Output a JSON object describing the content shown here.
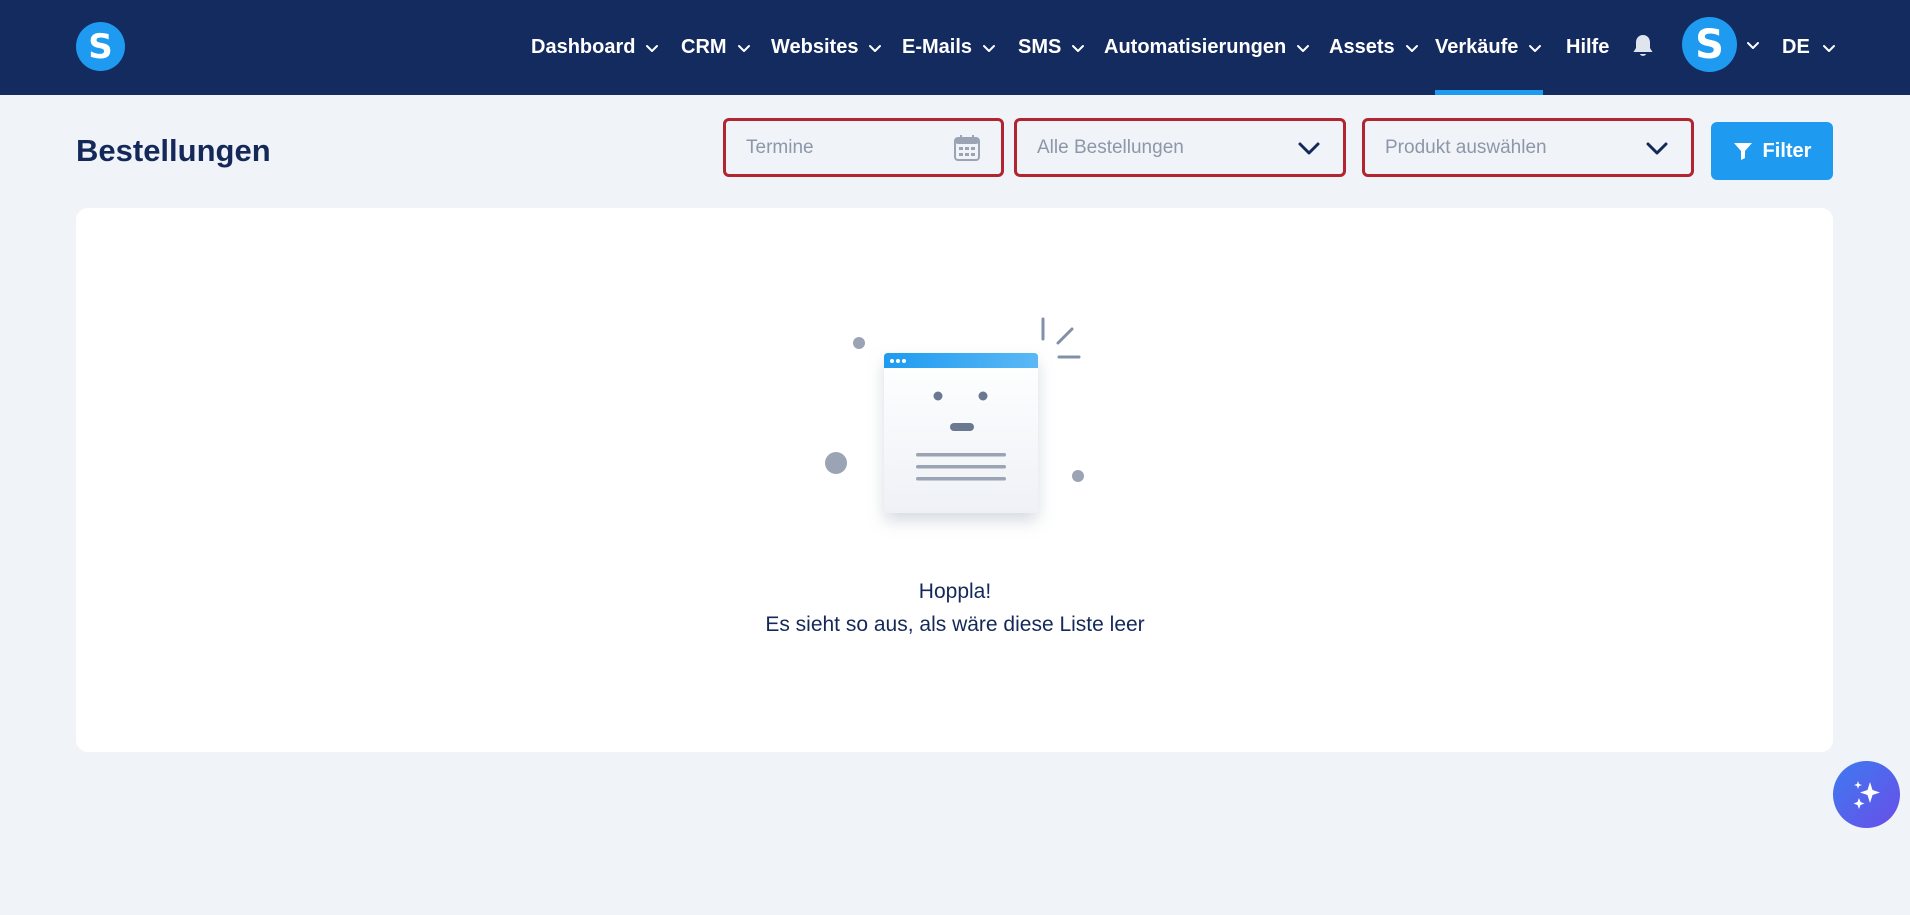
{
  "brand": {
    "logo_letter": "S"
  },
  "nav": {
    "items": [
      {
        "label": "Dashboard",
        "has_dropdown": true
      },
      {
        "label": "CRM",
        "has_dropdown": true
      },
      {
        "label": "Websites",
        "has_dropdown": true
      },
      {
        "label": "E-Mails",
        "has_dropdown": true
      },
      {
        "label": "SMS",
        "has_dropdown": true
      },
      {
        "label": "Automatisierungen",
        "has_dropdown": true
      },
      {
        "label": "Assets",
        "has_dropdown": true
      },
      {
        "label": "Verkäufe",
        "has_dropdown": true,
        "active": true
      },
      {
        "label": "Hilfe",
        "has_dropdown": false
      }
    ],
    "avatar_letter": "S",
    "language": "DE"
  },
  "page": {
    "title": "Bestellungen",
    "date_field": {
      "placeholder": "Termine",
      "icon": "calendar-icon"
    },
    "orders_select": {
      "placeholder": "Alle Bestellungen"
    },
    "product_select": {
      "placeholder": "Produkt auswählen"
    },
    "filter_label": "Filter"
  },
  "empty_state": {
    "title": "Hoppla!",
    "message": "Es sieht so aus, als wäre diese Liste leer"
  },
  "colors": {
    "topbar": "#142b5f",
    "accent": "#1e9bf0",
    "highlight_border": "#b0252f",
    "background": "#f0f4f9"
  }
}
